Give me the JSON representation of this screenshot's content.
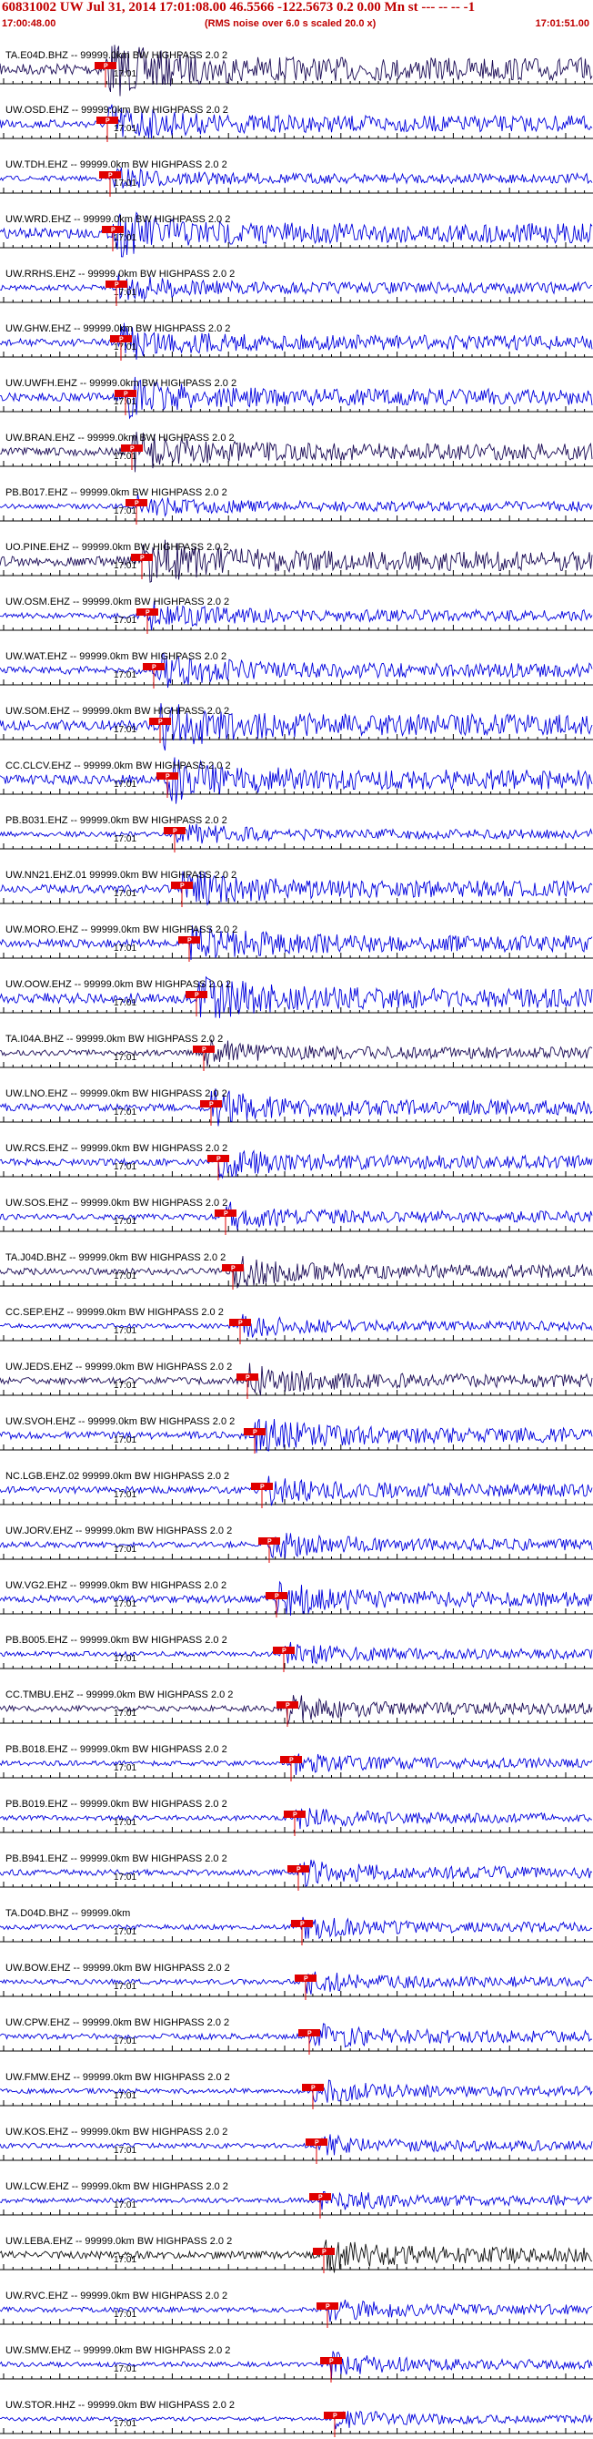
{
  "header": {
    "title": "60831002 UW Jul 31, 2014 17:01:08.00   46.5566 -122.5673  0.2 0.00 Mn st --- -- --  -1",
    "start_time": "17:00:48.00",
    "rms_note": "(RMS noise over 6.0 s scaled 20.0 x)",
    "end_time": "17:01:51.00"
  },
  "minute_label": "17:01",
  "pick_label": "P",
  "colors": {
    "title": "#c00000",
    "pick_marker": "#e00000",
    "trace_blue": "#0000dd",
    "trace_dark": "#1a0a55",
    "trace_black": "#111111",
    "axis": "#000000"
  },
  "traces": [
    {
      "label": "TA.E04D.BHZ -- 99999.0km BW  HIGHPASS  2.0  2",
      "color": "trace_dark"
    },
    {
      "label": "UW.OSD.EHZ -- 99999.0km BW  HIGHPASS  2.0  2",
      "color": "trace_blue"
    },
    {
      "label": "UW.TDH.EHZ -- 99999.0km BW  HIGHPASS  2.0  2",
      "color": "trace_blue"
    },
    {
      "label": "UW.WRD.EHZ -- 99999.0km BW  HIGHPASS  2.0  2",
      "color": "trace_blue"
    },
    {
      "label": "UW.RRHS.EHZ -- 99999.0km BW  HIGHPASS  2.0  2",
      "color": "trace_blue"
    },
    {
      "label": "UW.GHW.EHZ -- 99999.0km BW  HIGHPASS  2.0  2",
      "color": "trace_blue"
    },
    {
      "label": "UW.UWFH.EHZ -- 99999.0km BW  HIGHPASS  2.0  2",
      "color": "trace_blue"
    },
    {
      "label": "UW.BRAN.EHZ -- 99999.0km BW  HIGHPASS  2.0  2",
      "color": "trace_dark"
    },
    {
      "label": "PB.B017.EHZ -- 99999.0km BW  HIGHPASS  2.0  2",
      "color": "trace_blue"
    },
    {
      "label": "UO.PINE.EHZ -- 99999.0km BW  HIGHPASS  2.0  2",
      "color": "trace_dark"
    },
    {
      "label": "UW.OSM.EHZ -- 99999.0km BW  HIGHPASS  2.0  2",
      "color": "trace_blue"
    },
    {
      "label": "UW.WAT.EHZ -- 99999.0km BW  HIGHPASS  2.0  2",
      "color": "trace_blue"
    },
    {
      "label": "UW.SOM.EHZ -- 99999.0km BW  HIGHPASS  2.0  2",
      "color": "trace_blue"
    },
    {
      "label": "CC.CLCV.EHZ -- 99999.0km BW  HIGHPASS  2.0  2",
      "color": "trace_blue"
    },
    {
      "label": "PB.B031.EHZ -- 99999.0km BW  HIGHPASS  2.0  2",
      "color": "trace_blue"
    },
    {
      "label": "UW.NN21.EHZ.01 99999.0km BW  HIGHPASS  2.0  2",
      "color": "trace_blue"
    },
    {
      "label": "UW.MORO.EHZ -- 99999.0km BW  HIGHPASS  2.0  2",
      "color": "trace_blue"
    },
    {
      "label": "UW.OOW.EHZ -- 99999.0km BW  HIGHPASS  2.0  2",
      "color": "trace_blue"
    },
    {
      "label": "TA.I04A.BHZ -- 99999.0km BW  HIGHPASS  2.0  2",
      "color": "trace_dark"
    },
    {
      "label": "UW.LNO.EHZ -- 99999.0km BW  HIGHPASS  2.0  2",
      "color": "trace_blue"
    },
    {
      "label": "UW.RCS.EHZ -- 99999.0km BW  HIGHPASS  2.0  2",
      "color": "trace_blue"
    },
    {
      "label": "UW.SOS.EHZ -- 99999.0km BW  HIGHPASS  2.0  2",
      "color": "trace_blue"
    },
    {
      "label": "TA.J04D.BHZ -- 99999.0km BW  HIGHPASS  2.0  2",
      "color": "trace_dark"
    },
    {
      "label": "CC.SEP.EHZ -- 99999.0km BW  HIGHPASS  2.0  2",
      "color": "trace_blue"
    },
    {
      "label": "UW.JEDS.EHZ -- 99999.0km BW  HIGHPASS  2.0  2",
      "color": "trace_dark"
    },
    {
      "label": "UW.SVOH.EHZ -- 99999.0km BW  HIGHPASS  2.0  2",
      "color": "trace_blue"
    },
    {
      "label": "NC.LGB.EHZ.02 99999.0km BW  HIGHPASS  2.0  2",
      "color": "trace_blue"
    },
    {
      "label": "UW.JORV.EHZ -- 99999.0km BW  HIGHPASS  2.0  2",
      "color": "trace_blue"
    },
    {
      "label": "UW.VG2.EHZ -- 99999.0km BW  HIGHPASS  2.0  2",
      "color": "trace_blue"
    },
    {
      "label": "PB.B005.EHZ -- 99999.0km BW  HIGHPASS  2.0  2",
      "color": "trace_blue"
    },
    {
      "label": "CC.TMBU.EHZ -- 99999.0km BW  HIGHPASS  2.0  2",
      "color": "trace_dark"
    },
    {
      "label": "PB.B018.EHZ -- 99999.0km BW  HIGHPASS  2.0  2",
      "color": "trace_blue"
    },
    {
      "label": "PB.B019.EHZ -- 99999.0km BW  HIGHPASS  2.0  2",
      "color": "trace_blue"
    },
    {
      "label": "PB.B941.EHZ -- 99999.0km BW  HIGHPASS  2.0  2",
      "color": "trace_blue"
    },
    {
      "label": "TA.D04D.BHZ -- 99999.0km",
      "color": "trace_blue"
    },
    {
      "label": "UW.BOW.EHZ -- 99999.0km BW  HIGHPASS  2.0  2",
      "color": "trace_blue"
    },
    {
      "label": "UW.CPW.EHZ -- 99999.0km BW  HIGHPASS  2.0  2",
      "color": "trace_blue"
    },
    {
      "label": "UW.FMW.EHZ -- 99999.0km BW  HIGHPASS  2.0  2",
      "color": "trace_blue"
    },
    {
      "label": "UW.KOS.EHZ -- 99999.0km BW  HIGHPASS  2.0  2",
      "color": "trace_blue"
    },
    {
      "label": "UW.LCW.EHZ -- 99999.0km BW  HIGHPASS  2.0  2",
      "color": "trace_blue"
    },
    {
      "label": "UW.LEBA.EHZ -- 99999.0km BW  HIGHPASS  2.0  2",
      "color": "trace_black"
    },
    {
      "label": "UW.RVC.EHZ -- 99999.0km BW  HIGHPASS  2.0  2",
      "color": "trace_blue"
    },
    {
      "label": "UW.SMW.EHZ -- 99999.0km BW  HIGHPASS  2.0  2",
      "color": "trace_blue"
    },
    {
      "label": "UW.STOR.HHZ -- 99999.0km BW  HIGHPASS  2.0  2",
      "color": "trace_blue"
    }
  ]
}
